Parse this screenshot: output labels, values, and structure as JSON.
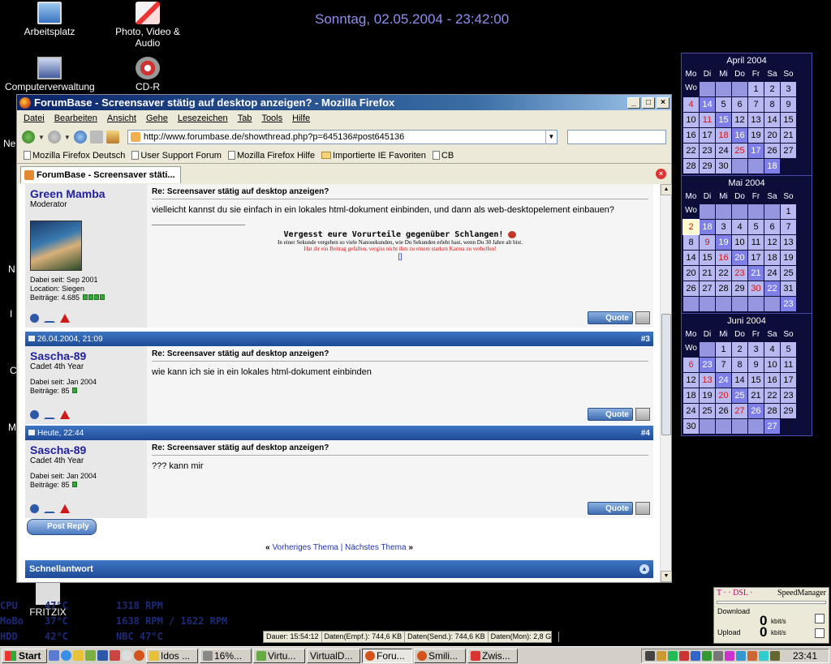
{
  "desktop": {
    "clock": "Sonntag, 02.05.2004 - 23:42:00",
    "icons": [
      "Arbeitsplatz",
      "Photo, Video & Audio",
      "Computerverwaltung",
      "CD-R",
      "FRITZIX"
    ],
    "edge_letters": [
      "Ne",
      "N",
      "I",
      "C",
      "M"
    ],
    "sysinfo": [
      [
        "CPU",
        "47°C",
        "1318 RPM"
      ],
      [
        "MoBo",
        "37°C",
        "1638 RPM / 1622 RPM"
      ],
      [
        "HDD",
        "42°C",
        "NBC 47°C"
      ]
    ]
  },
  "calendars": {
    "weekdays": [
      "Mo",
      "Di",
      "Mi",
      "Do",
      "Fr",
      "Sa",
      "So",
      "Wo"
    ],
    "months": [
      {
        "title": "April 2004",
        "weeks": [
          [
            "",
            "",
            "",
            "1",
            "2",
            "3",
            "4",
            "14"
          ],
          [
            "5",
            "6",
            "7",
            "8",
            "9",
            "10",
            "11",
            "15"
          ],
          [
            "12",
            "13",
            "14",
            "15",
            "16",
            "17",
            "18",
            "16"
          ],
          [
            "19",
            "20",
            "21",
            "22",
            "23",
            "24",
            "25",
            "17"
          ],
          [
            "26",
            "27",
            "28",
            "29",
            "30",
            "",
            "",
            "18"
          ]
        ],
        "today": ""
      },
      {
        "title": "Mai 2004",
        "weeks": [
          [
            "",
            "",
            "",
            "",
            "",
            "1",
            "2",
            "18"
          ],
          [
            "3",
            "4",
            "5",
            "6",
            "7",
            "8",
            "9",
            "19"
          ],
          [
            "10",
            "11",
            "12",
            "13",
            "14",
            "15",
            "16",
            "20"
          ],
          [
            "17",
            "18",
            "19",
            "20",
            "21",
            "22",
            "23",
            "21"
          ],
          [
            "24",
            "25",
            "26",
            "27",
            "28",
            "29",
            "30",
            "22"
          ],
          [
            "31",
            "",
            "",
            "",
            "",
            "",
            "",
            "23"
          ]
        ],
        "today": "2"
      },
      {
        "title": "Juni 2004",
        "weeks": [
          [
            "",
            "1",
            "2",
            "3",
            "4",
            "5",
            "6",
            "23"
          ],
          [
            "7",
            "8",
            "9",
            "10",
            "11",
            "12",
            "13",
            "24"
          ],
          [
            "14",
            "15",
            "16",
            "17",
            "18",
            "19",
            "20",
            "25"
          ],
          [
            "21",
            "22",
            "23",
            "24",
            "25",
            "26",
            "27",
            "26"
          ],
          [
            "28",
            "29",
            "30",
            "",
            "",
            "",
            "",
            "27"
          ]
        ],
        "today": ""
      }
    ]
  },
  "browser": {
    "title": "ForumBase - Screensaver stätig auf desktop anzeigen? - Mozilla Firefox",
    "window_buttons": [
      "_",
      "□",
      "×"
    ],
    "menu": [
      "Datei",
      "Bearbeiten",
      "Ansicht",
      "Gehe",
      "Lesezeichen",
      "Tab",
      "Tools",
      "Hilfe"
    ],
    "url": "http://www.forumbase.de/showthread.php?p=645136#post645136",
    "bookmarks": [
      "Mozilla Firefox Deutsch",
      "User Support Forum",
      "Mozilla Firefox Hilfe",
      "Importierte IE Favoriten",
      "CB"
    ],
    "tab_label": "ForumBase - Screensaver stäti..."
  },
  "posts": [
    {
      "date": "",
      "number": "",
      "username": "Green Mamba",
      "rank": "Moderator",
      "joined": "Dabei seit: Sep 2001",
      "location": "Location: Siegen",
      "posts_count": "Beiträge: 4.685",
      "title": "Re: Screensaver stätig auf desktop anzeigen?",
      "text": "vielleicht kannst du sie einfach in ein lokales html-dokument einbinden, und dann als web-desktopelement einbauen?",
      "sig_line1": "Vergesst eure Vorurteile gegenüber Schlangen!",
      "sig_line2": "In einer Sekunde vergehen so viele Nanosekunden, wie Du Sekunden erlebt hast, wenn Du 30 Jahre alt bist.",
      "sig_line3": "Hat dir ein Beitrag gefallen, vergiss nicht ihm zu einem starken Karma zu verhelfen!",
      "sig_line4": "[]",
      "quote_label": "Quote"
    },
    {
      "date": "26.04.2004, 21:09",
      "number": "#3",
      "username": "Sascha-89",
      "rank": "Cadet 4th Year",
      "joined": "Dabei seit: Jan 2004",
      "posts_count": "Beiträge: 85",
      "title": "Re: Screensaver stätig auf desktop anzeigen?",
      "text": "wie kann ich sie in ein lokales html-dokument einbinden",
      "quote_label": "Quote"
    },
    {
      "date": "Heute, 22:44",
      "number": "#4",
      "username": "Sascha-89",
      "rank": "Cadet 4th Year",
      "joined": "Dabei seit: Jan 2004",
      "posts_count": "Beiträge: 85",
      "title": "Re: Screensaver stätig auf desktop anzeigen?",
      "text": "??? kann mir",
      "quote_label": "Quote"
    }
  ],
  "forum": {
    "post_reply": "Post Reply",
    "prev_thread": "Vorheriges Thema",
    "next_thread": "Nächstes Thema",
    "nav_sep": "|",
    "quick_reply": "Schnellantwort"
  },
  "statusbar": [
    "Dauer: 15:54:12",
    "Daten(Empf.): 744,6 KB",
    "Daten(Send.): 744,6 KB",
    "Daten(Mon): 2,8 GB"
  ],
  "speedmanager": {
    "brand": "T · · DSL ·",
    "title": "SpeedManager",
    "download_label": "Download",
    "upload_label": "Upload",
    "download_value": "0",
    "upload_value": "0",
    "unit": "kbit/s"
  },
  "taskbar": {
    "start": "Start",
    "tasks": [
      "Idos ...",
      "16%...",
      "Virtu...",
      "VirtualD...",
      "Foru...",
      "Smili...",
      "Zwis..."
    ],
    "active_task": 4,
    "tray_clock": "23:41"
  },
  "colors": {
    "desktop_bg": "#000000",
    "calendar_cell": "#b9b9f2",
    "forum_header": "#1e4a96",
    "sunday": "#d01818"
  }
}
